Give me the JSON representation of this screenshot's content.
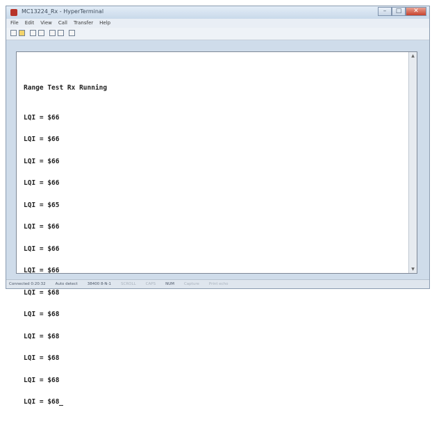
{
  "window": {
    "title": "MC13224_Rx - HyperTerminal",
    "controls": {
      "minimize": "–",
      "maximize": "□",
      "close": "✕"
    }
  },
  "menu": [
    "File",
    "Edit",
    "View",
    "Call",
    "Transfer",
    "Help"
  ],
  "toolbar": [
    "new-icon",
    "open-icon",
    "disconnect-icon",
    "properties-icon",
    "send-icon",
    "receive-icon",
    "settings-icon"
  ],
  "terminal": {
    "heading": "Range Test Rx Running",
    "lines": [
      "LQI = $66",
      "LQI = $66",
      "LQI = $66",
      "LQI = $66",
      "LQI = $65",
      "LQI = $66",
      "LQI = $66",
      "LQI = $66",
      "LQI = $68",
      "LQI = $68",
      "LQI = $68",
      "LQI = $68",
      "LQI = $68",
      "LQI = $68"
    ]
  },
  "status": {
    "connection": "Connected 0:20:32",
    "detect": "Auto detect",
    "settings": "38400 8-N-1",
    "scroll": "SCROLL",
    "caps": "CAPS",
    "num": "NUM",
    "capture": "Capture",
    "print_echo": "Print echo"
  }
}
